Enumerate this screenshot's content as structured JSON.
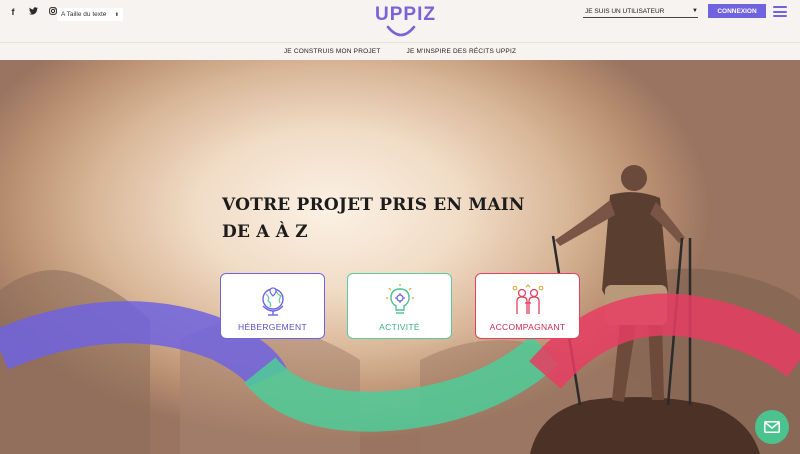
{
  "header": {
    "social": [
      {
        "name": "facebook-icon",
        "glyph": "f"
      },
      {
        "name": "twitter-icon",
        "glyph": "t"
      },
      {
        "name": "instagram-icon",
        "glyph": "◎"
      }
    ],
    "text_size_label": "A Taille du texte",
    "logo_text": "UPPIZ",
    "user_type_select": "JE SUIS UN UTILISATEUR",
    "login_button": "CONNEXION"
  },
  "nav": {
    "items": [
      {
        "label": "JE CONSTRUIS MON PROJET"
      },
      {
        "label": "JE M'INSPIRE DES RÉCITS UPPIZ"
      }
    ]
  },
  "hero": {
    "title_line1": "VOTRE PROJET PRIS EN MAIN",
    "title_line2": "DE A À Z",
    "cards": [
      {
        "label": "HÉBERGEMENT",
        "icon": "globe-icon",
        "color": "#6f63e0"
      },
      {
        "label": "ACTIVITÉ",
        "icon": "lightbulb-icon",
        "color": "#5cc9a1"
      },
      {
        "label": "ACCOMPAGNANT",
        "icon": "people-icon",
        "color": "#e0415f"
      }
    ]
  },
  "colors": {
    "brand_purple": "#6f63e0",
    "green": "#5cc9a1",
    "pink": "#e0415f"
  },
  "chat": {
    "icon": "mail-icon"
  }
}
